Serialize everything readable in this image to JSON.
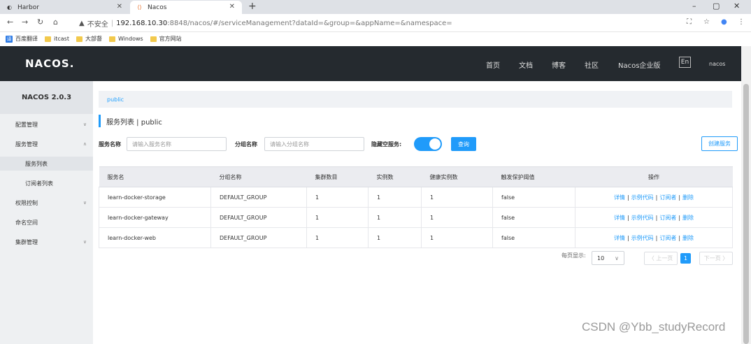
{
  "browser": {
    "tabs": [
      {
        "title": "Harbor",
        "active": false
      },
      {
        "title": "Nacos",
        "active": true
      }
    ],
    "new_tab": "+",
    "url": {
      "security": "不安全",
      "host": "192.168.10.30",
      "rest": ":8848/nacos/#/serviceManagement?dataId=&group=&appName=&namespace="
    },
    "bookmarks": [
      "百度翻译",
      "itcast",
      "大部督",
      "Windows",
      "官方网站"
    ]
  },
  "topnav": {
    "logo": "NACOS.",
    "menu": [
      "首页",
      "文档",
      "博客",
      "社区",
      "Nacos企业版"
    ],
    "lang": "En",
    "user": "nacos"
  },
  "sidebar": {
    "title": "NACOS 2.0.3",
    "items": [
      {
        "label": "配置管理",
        "caret": "∨"
      },
      {
        "label": "服务管理",
        "caret": "∧"
      },
      {
        "label": "服务列表"
      },
      {
        "label": "订阅者列表"
      },
      {
        "label": "权限控制",
        "caret": "∨"
      },
      {
        "label": "命名空间"
      },
      {
        "label": "集群管理",
        "caret": "∨"
      }
    ]
  },
  "main": {
    "breadcrumb": "public",
    "title": "服务列表  |  public",
    "filters": {
      "service_label": "服务名称",
      "service_placeholder": "请输入服务名称",
      "group_label": "分组名称",
      "group_placeholder": "请输入分组名称",
      "hide_empty_label": "隐藏空服务:",
      "hide_empty_on": true,
      "query": "查询",
      "create": "创建服务"
    },
    "table": {
      "headers": [
        "服务名",
        "分组名称",
        "集群数目",
        "实例数",
        "健康实例数",
        "触发保护阈值",
        "操作"
      ],
      "rows": [
        {
          "name": "learn-docker-storage",
          "group": "DEFAULT_GROUP",
          "clusters": "1",
          "instances": "1",
          "healthy": "1",
          "threshold": "false"
        },
        {
          "name": "learn-docker-gateway",
          "group": "DEFAULT_GROUP",
          "clusters": "1",
          "instances": "1",
          "healthy": "1",
          "threshold": "false"
        },
        {
          "name": "learn-docker-web",
          "group": "DEFAULT_GROUP",
          "clusters": "1",
          "instances": "1",
          "healthy": "1",
          "threshold": "false"
        }
      ],
      "ops": [
        "详情",
        "示例代码",
        "订阅者",
        "删除"
      ]
    },
    "pagination": {
      "per_page_label": "每页显示:",
      "per_page": "10",
      "prev": "〈 上一页",
      "current": "1",
      "next": "下一页 〉"
    }
  },
  "watermark": "CSDN @Ybb_studyRecord",
  "colors": {
    "accent": "#209bfa",
    "nav_bg": "#252a2f",
    "sidebar_bg": "#eef0f2"
  }
}
